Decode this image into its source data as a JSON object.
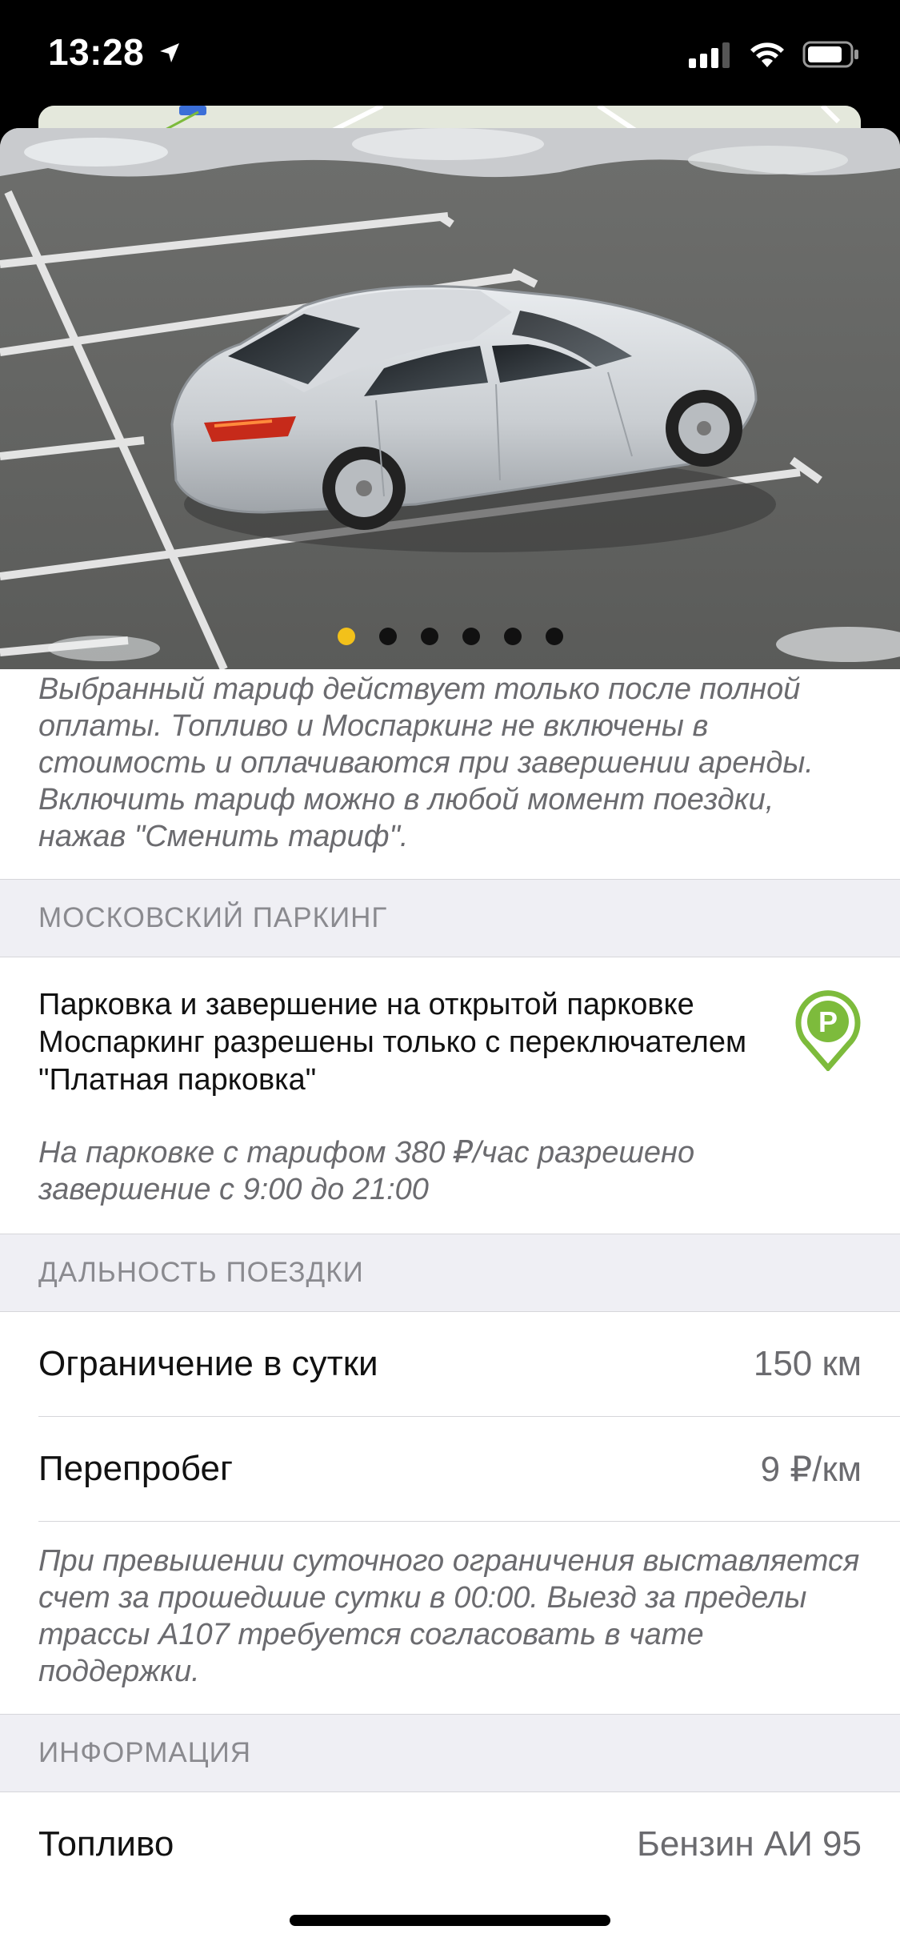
{
  "status_bar": {
    "time": "13:28"
  },
  "carousel": {
    "image_alt": "car-photo-silver-sedan",
    "slide_count": 6,
    "active_index": 0,
    "active_color": "#f3c11a"
  },
  "tariff_note": "Выбранный тариф действует только после полной оплаты. Топливо и Моспаркинг не включены в стоимость и оплачиваются при завершении аренды. Включить тариф можно в любой момент поездки, нажав \"Сменить тариф\".",
  "parking_section": {
    "header": "МОСКОВСКИЙ ПАРКИНГ",
    "main_text": "Парковка и завершение на открытой парковке Моспаркинг разрешены только с переключателем \"Платная парковка\"",
    "note": "На парковке с тарифом 380 ₽/час разрешено завершение с 9:00 до 21:00",
    "icon_color": "#7dbb3c"
  },
  "distance_section": {
    "header": "ДАЛЬНОСТЬ ПОЕЗДКИ",
    "rows": [
      {
        "label": "Ограничение в сутки",
        "value": "150 км"
      },
      {
        "label": "Перепробег",
        "value": "9 ₽/км"
      }
    ],
    "note": "При превышении суточного ограничения выставляется счет за прошедшие сутки в 00:00. Выезд за пределы трассы А107 требуется согласовать в чате поддержки."
  },
  "info_section": {
    "header": "ИНФОРМАЦИЯ",
    "rows": [
      {
        "label": "Топливо",
        "value": "Бензин АИ 95"
      }
    ]
  }
}
